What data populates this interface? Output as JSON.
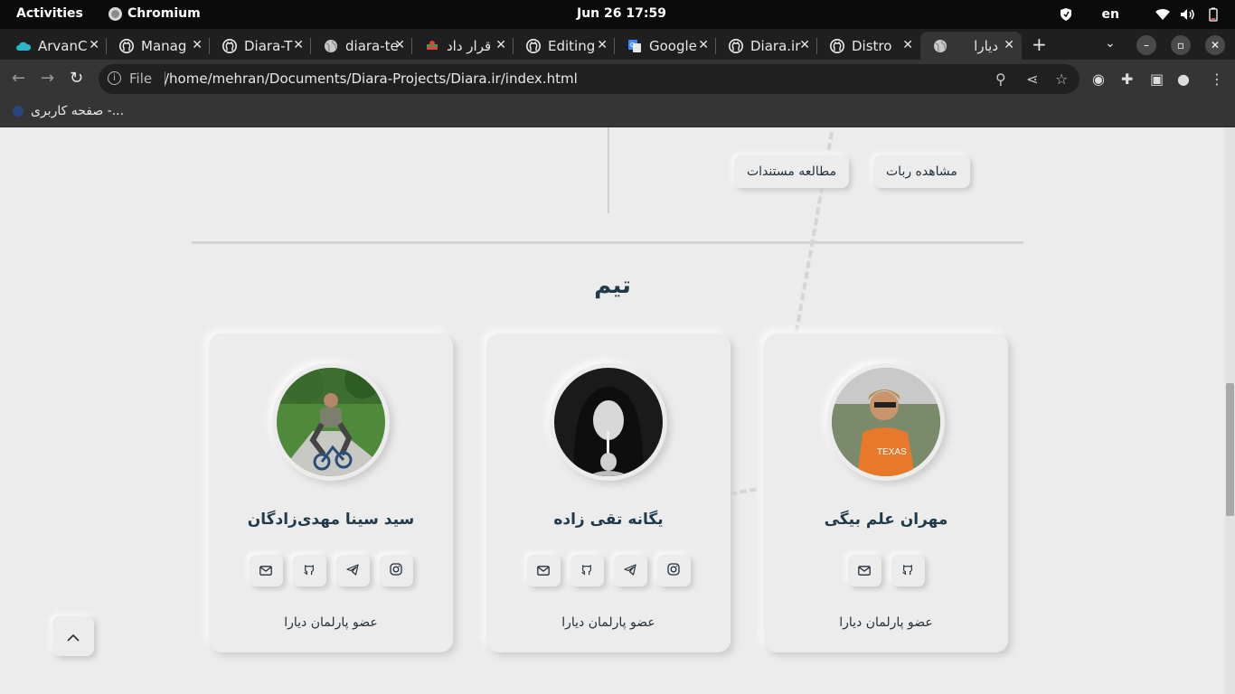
{
  "system": {
    "activities": "Activities",
    "app_name": "Chromium",
    "clock": "Jun 26  17:59",
    "language": "en"
  },
  "tabs": [
    {
      "title": "ArvanC",
      "icon": "arvan-cloud-icon"
    },
    {
      "title": "Manag",
      "icon": "github-icon"
    },
    {
      "title": "Diara-T",
      "icon": "github-icon"
    },
    {
      "title": "diara-te",
      "icon": "globe-icon"
    },
    {
      "title": "قرار داد",
      "icon": "flag-icon"
    },
    {
      "title": "Editing",
      "icon": "github-icon"
    },
    {
      "title": "Google",
      "icon": "google-translate-icon"
    },
    {
      "title": "Diara.ir",
      "icon": "github-icon"
    },
    {
      "title": "Distro",
      "icon": "github-icon"
    },
    {
      "title": "دیارا",
      "icon": "globe-icon",
      "active": true
    }
  ],
  "toolbar": {
    "file_label": "File",
    "url": "/home/mehran/Documents/Diara-Projects/Diara.ir/index.html"
  },
  "bookmarks": [
    {
      "label": "صفحه کاربری -..."
    }
  ],
  "page": {
    "buttons": {
      "view_bot": "مشاهده ربات",
      "read_docs": "مطالعه مستندات"
    },
    "team_title": "تیم",
    "members": [
      {
        "name": "مهران علم بیگی",
        "role": "عضو پارلمان دیارا",
        "links": [
          "email",
          "github"
        ]
      },
      {
        "name": "یگانه تقی زاده",
        "role": "عضو پارلمان دیارا",
        "links": [
          "email",
          "github",
          "telegram",
          "instagram"
        ]
      },
      {
        "name": "سید سینا مهدی‌زادگان",
        "role": "عضو پارلمان دیارا",
        "links": [
          "email",
          "github",
          "telegram",
          "instagram"
        ]
      }
    ]
  },
  "colors": {
    "page_bg": "#ececec",
    "heading": "#1f3a4a",
    "chrome_dark": "#353535"
  }
}
